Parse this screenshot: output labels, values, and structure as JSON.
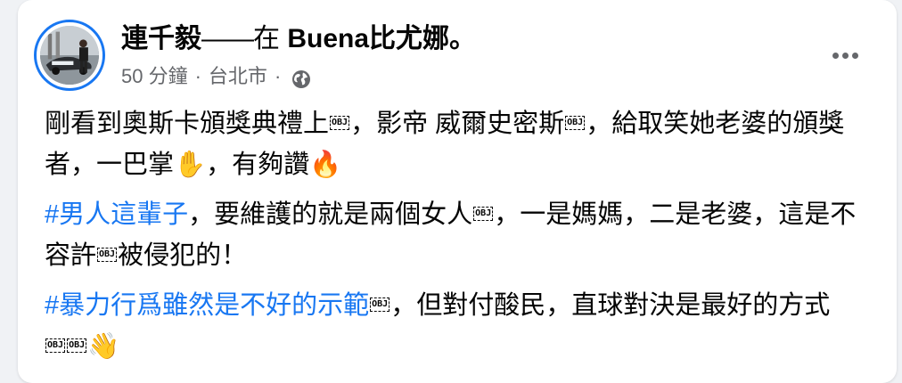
{
  "post": {
    "author": "連千毅",
    "separator": "——",
    "with_text": "在 ",
    "tagged_place": "Buena比尤娜。",
    "time": "50 分鐘",
    "dot": "·",
    "location": "台北市",
    "privacy_icon": "globe-icon",
    "more_icon": "more-horiz-icon",
    "body": {
      "p1": {
        "t1": "剛看到奧斯卡頒獎典禮上",
        "obj1": "OBJ",
        "t2": "，影帝 威爾史密斯",
        "obj2": "OBJ",
        "t3": "，給取笑她老婆的頒獎者，一巴掌",
        "emoji1": "✋",
        "t4": "，有夠讚",
        "emoji2": "🔥"
      },
      "p2": {
        "hashtag": "#男人這輩子",
        "t1": "，要維護的就是兩個女人",
        "obj1": "OBJ",
        "t2": "，一是媽媽，二是老婆，這是不容許",
        "obj2": "OBJ",
        "t3": "被侵犯的！"
      },
      "p3": {
        "hashtag": "#暴力行爲雖然是不好的示範",
        "obj1": "OBJ",
        "t1": "，但對付酸民，直球對決是最好的方式",
        "obj2": "OBJ",
        "obj3": "OBJ",
        "emoji": "👋"
      }
    }
  },
  "colors": {
    "link": "#1877f2",
    "text": "#050505",
    "secondary": "#65676b",
    "background": "#f0f2f5",
    "card": "#ffffff"
  }
}
